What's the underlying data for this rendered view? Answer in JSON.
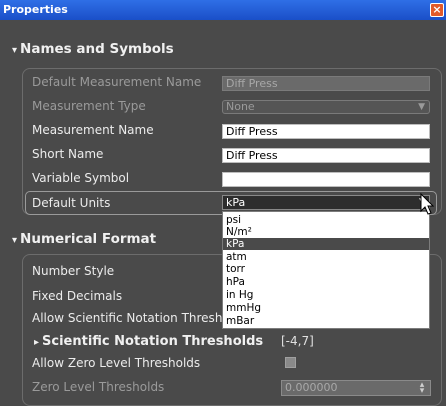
{
  "window": {
    "title": "Properties",
    "close_glyph": "×"
  },
  "names_section": {
    "title": "Names and Symbols",
    "rows": {
      "default_measurement_name": {
        "label": "Default Measurement Name",
        "value": "Diff Press"
      },
      "measurement_type": {
        "label": "Measurement Type",
        "value": "None"
      },
      "measurement_name": {
        "label": "Measurement Name",
        "value": "Diff Press"
      },
      "short_name": {
        "label": "Short Name",
        "value": "Diff Press"
      },
      "variable_symbol": {
        "label": "Variable Symbol",
        "value": ""
      },
      "default_units": {
        "label": "Default Units",
        "value": "kPa"
      }
    },
    "units_options": [
      "psi",
      "N/m²",
      "kPa",
      "atm",
      "torr",
      "hPa",
      "in Hg",
      "mmHg",
      "mBar"
    ],
    "selected_unit": "kPa"
  },
  "numerical_section": {
    "title": "Numerical Format",
    "rows": {
      "number_style": {
        "label": "Number Style"
      },
      "fixed_decimals": {
        "label": "Fixed Decimals"
      },
      "allow_sci": {
        "label": "Allow Scientific Notation Thresh"
      },
      "sci_thresholds": {
        "label": "Scientific Notation Thresholds",
        "value": "[-4,7]"
      },
      "allow_zero": {
        "label": "Allow Zero Level Thresholds",
        "checked": false
      },
      "zero_thresholds": {
        "label": "Zero Level Thresholds",
        "value": "0.000000"
      }
    }
  },
  "colors": {
    "accent": "#2f6fe6",
    "panel": "#4a4a4a",
    "selected": "#4a4a4a"
  }
}
